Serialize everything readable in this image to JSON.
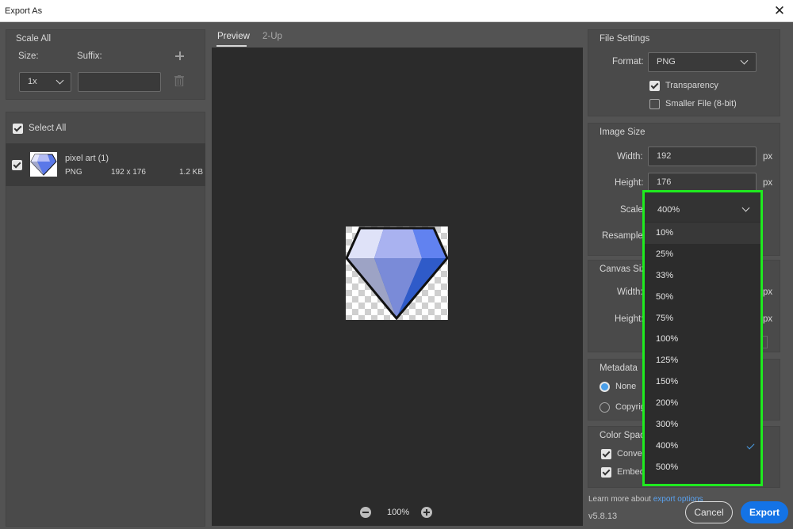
{
  "window": {
    "title": "Export As",
    "close": "✕"
  },
  "left": {
    "scale_all": "Scale All",
    "size_label": "Size:",
    "suffix_label": "Suffix:",
    "size_value": "1x",
    "suffix_value": "",
    "select_all": "Select All",
    "file": {
      "name": "pixel art (1)",
      "format": "PNG",
      "dimensions": "192 x 176",
      "filesize": "1.2 KB"
    }
  },
  "preview": {
    "tabs": [
      {
        "label": "Preview"
      },
      {
        "label": "2-Up"
      }
    ],
    "zoom": "100%"
  },
  "file_settings": {
    "title": "File Settings",
    "format_label": "Format:",
    "format_value": "PNG",
    "transparency": "Transparency",
    "smaller_file": "Smaller File (8-bit)"
  },
  "image_size": {
    "title": "Image Size",
    "width_label": "Width:",
    "width_value": "192",
    "height_label": "Height:",
    "height_value": "176",
    "unit": "px",
    "scale_label": "Scale:",
    "resample_label": "Resample:"
  },
  "scale_dropdown": {
    "selected": "400%",
    "options": [
      "10%",
      "25%",
      "33%",
      "50%",
      "75%",
      "100%",
      "125%",
      "150%",
      "200%",
      "300%",
      "400%",
      "500%"
    ],
    "highlight_color": "#1fea1f",
    "check_color": "#4a9fe9"
  },
  "canvas_size": {
    "title": "Canvas Size",
    "width_label": "Width:",
    "height_label": "Height:",
    "unit": "px"
  },
  "metadata": {
    "title": "Metadata",
    "none": "None",
    "copyright": "Copyrig"
  },
  "color_space": {
    "title": "Color Space",
    "convert": "Conver",
    "embed": "Embed"
  },
  "footer": {
    "learn_more": "Learn more about",
    "learn_link": "export options",
    "version": "v5.8.13",
    "cancel": "Cancel",
    "export": "Export"
  }
}
